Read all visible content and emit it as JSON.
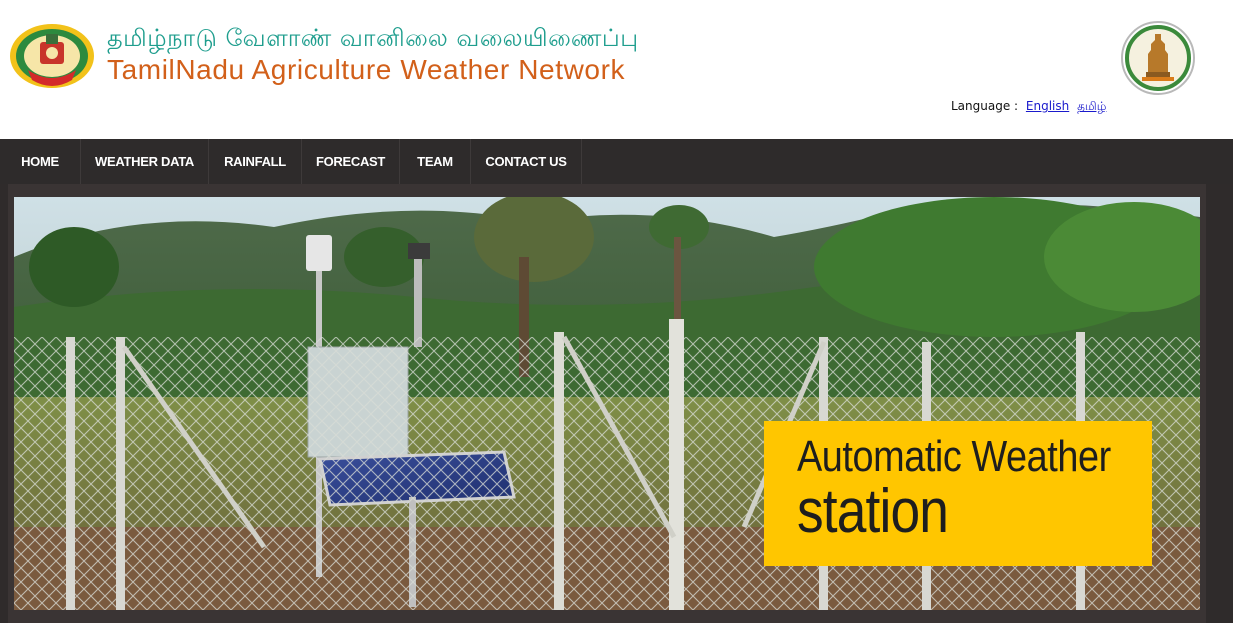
{
  "header": {
    "title_tamil": "தமிழ்நாடு வேளாண் வானிலை வலையிணைப்பு",
    "title_english": "TamilNadu Agriculture Weather Network",
    "language_label": "Language :",
    "language_links": [
      "English",
      "தமிழ்"
    ]
  },
  "nav": {
    "items": [
      "HOME",
      "WEATHER DATA",
      "RAINFALL",
      "FORECAST",
      "TEAM",
      "CONTACT US"
    ]
  },
  "banner": {
    "caption_line1": "Automatic Weather",
    "caption_line2": "station"
  },
  "colors": {
    "tamil_title": "#1f9e8e",
    "english_title": "#d2601a",
    "nav_bg": "#2e2b2b",
    "caption_bg": "#ffc600",
    "link": "#1a1acc"
  },
  "icons": {
    "left_logo": "tnau-emblem-icon",
    "right_logo": "tamilnadu-state-emblem-icon"
  }
}
